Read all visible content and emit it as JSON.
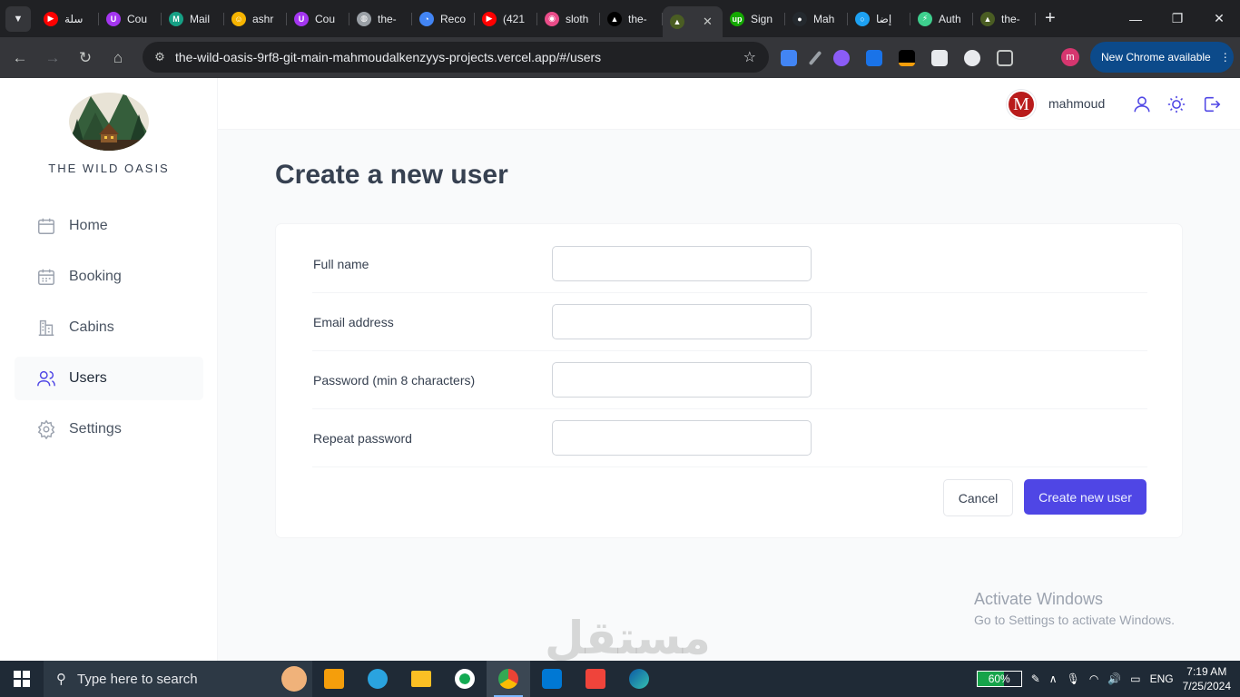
{
  "browser": {
    "tabs": [
      {
        "title": "سلة",
        "color": "#ff0000",
        "glyph": "▶"
      },
      {
        "title": "Cou",
        "color": "#a435f0",
        "glyph": "U"
      },
      {
        "title": "Mail",
        "color": "#16a085",
        "glyph": "M"
      },
      {
        "title": "ashr",
        "color": "#f6b400",
        "glyph": "☺"
      },
      {
        "title": "Cou",
        "color": "#a435f0",
        "glyph": "U"
      },
      {
        "title": "the-",
        "color": "#9aa0a6",
        "glyph": "◍"
      },
      {
        "title": "Reco",
        "color": "#4285f4",
        "glyph": "◔"
      },
      {
        "title": "(421",
        "color": "#ff0000",
        "glyph": "▶"
      },
      {
        "title": "sloth",
        "color": "#ea4c89",
        "glyph": "◉"
      },
      {
        "title": "the-",
        "color": "#000000",
        "glyph": "▲"
      },
      {
        "title": "",
        "color": "#4a5d23",
        "glyph": "▲",
        "active": true
      },
      {
        "title": "Sign",
        "color": "#14a800",
        "glyph": "up"
      },
      {
        "title": "Mah",
        "color": "#24292e",
        "glyph": "●"
      },
      {
        "title": "إضا",
        "color": "#1da1f2",
        "glyph": "○"
      },
      {
        "title": "Auth",
        "color": "#3ecf8e",
        "glyph": "⚡"
      },
      {
        "title": "the-",
        "color": "#4a5d23",
        "glyph": "▲"
      }
    ],
    "url": "the-wild-oasis-9rf8-git-main-mahmoudalkenzyys-projects.vercel.app/#/users",
    "profile_initial": "m",
    "update_label": "New Chrome available"
  },
  "app": {
    "logo_text": "THE WILD OASIS",
    "nav": [
      {
        "label": "Home",
        "icon": "home-icon",
        "active": false
      },
      {
        "label": "Booking",
        "icon": "calendar-icon",
        "active": false
      },
      {
        "label": "Cabins",
        "icon": "cabins-icon",
        "active": false
      },
      {
        "label": "Users",
        "icon": "users-icon",
        "active": true
      },
      {
        "label": "Settings",
        "icon": "settings-icon",
        "active": false
      }
    ],
    "header": {
      "avatar_initial": "M",
      "username": "mahmoud"
    },
    "page_title": "Create a new user",
    "form": {
      "fields": [
        {
          "label": "Full name",
          "value": "",
          "type": "text"
        },
        {
          "label": "Email address",
          "value": "",
          "type": "email"
        },
        {
          "label": "Password (min 8 characters)",
          "value": "",
          "type": "password"
        },
        {
          "label": "Repeat password",
          "value": "",
          "type": "password"
        }
      ],
      "cancel_label": "Cancel",
      "submit_label": "Create new user"
    }
  },
  "overlay": {
    "activate_title": "Activate Windows",
    "activate_sub": "Go to Settings to activate Windows.",
    "watermark": "مستقل"
  },
  "taskbar": {
    "search_placeholder": "Type here to search",
    "battery": "60%",
    "battery_level": 0.6,
    "language": "ENG",
    "time": "7:19 AM",
    "date": "7/25/2024"
  },
  "colors": {
    "brand_indigo": "#4f46e5",
    "avatar_red": "#b91c1c"
  }
}
